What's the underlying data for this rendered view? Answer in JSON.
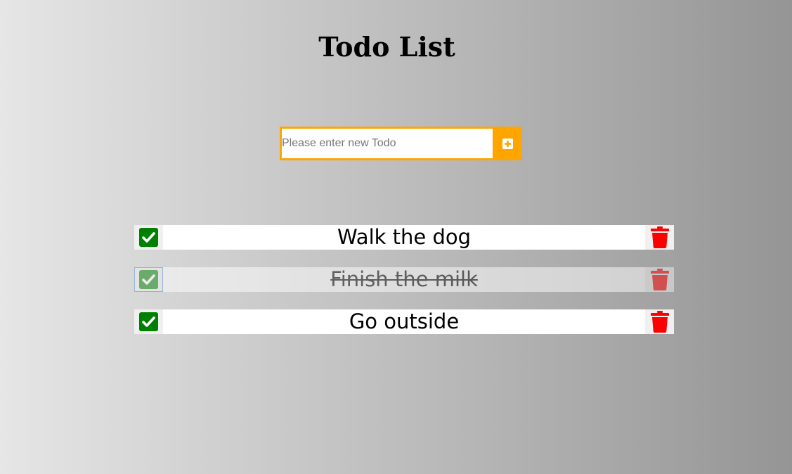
{
  "page": {
    "title": "Todo List"
  },
  "form": {
    "input_value": "",
    "input_placeholder": "Please enter new Todo",
    "add_button_icon": "plus-square-icon"
  },
  "todos": [
    {
      "text": "Walk the dog",
      "completed": false
    },
    {
      "text": "Finish the milk",
      "completed": true
    },
    {
      "text": "Go outside",
      "completed": false
    }
  ],
  "icons": {
    "check": "check-square-icon",
    "trash": "trash-icon"
  },
  "colors": {
    "accent": "#ffa500",
    "check": "#008000",
    "trash": "#ff0000",
    "background_start": "#e6e6e6",
    "background_end": "#959595"
  }
}
